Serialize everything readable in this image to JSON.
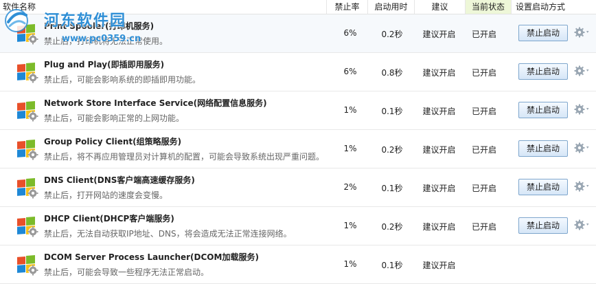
{
  "header": {
    "name": "软件名称",
    "rate": "禁止率",
    "time": "启动用时",
    "suggest": "建议",
    "state": "当前状态",
    "mode": "设置启动方式"
  },
  "watermark": {
    "title": "河东软件园",
    "url": "www.pc0359.cn"
  },
  "colors": {
    "state_header_bg": "#eef7d8",
    "button_border": "#7ea6cc",
    "watermark": "#2f8fd6"
  },
  "rows": [
    {
      "name": "Print Spooler(打印机服务)",
      "desc": "禁止后，打印机将无法正常使用。",
      "rate": "6%",
      "time": "0.2秒",
      "suggest": "建议开启",
      "state": "已开启",
      "button": "禁止启动",
      "has_button": true
    },
    {
      "name": "Plug and Play(即插即用服务)",
      "desc": "禁止后，可能会影响系统的即插即用功能。",
      "rate": "6%",
      "time": "0.8秒",
      "suggest": "建议开启",
      "state": "已开启",
      "button": "禁止启动",
      "has_button": true
    },
    {
      "name": "Network Store Interface Service(网络配置信息服务)",
      "desc": "禁止后，可能会影响正常的上网功能。",
      "rate": "1%",
      "time": "0.1秒",
      "suggest": "建议开启",
      "state": "已开启",
      "button": "禁止启动",
      "has_button": true
    },
    {
      "name": "Group Policy Client(组策略服务)",
      "desc": "禁止后，将不再应用管理员对计算机的配置，可能会导致系统出现严重问题。",
      "rate": "1%",
      "time": "0.2秒",
      "suggest": "建议开启",
      "state": "已开启",
      "button": "禁止启动",
      "has_button": true
    },
    {
      "name": "DNS Client(DNS客户端高速缓存服务)",
      "desc": "禁止后，打开网站的速度会变慢。",
      "rate": "2%",
      "time": "0.1秒",
      "suggest": "建议开启",
      "state": "已开启",
      "button": "禁止启动",
      "has_button": true
    },
    {
      "name": "DHCP Client(DHCP客户端服务)",
      "desc": "禁止后，无法自动获取IP地址、DNS，将会造成无法正常连接网络。",
      "rate": "1%",
      "time": "0.2秒",
      "suggest": "建议开启",
      "state": "已开启",
      "button": "禁止启动",
      "has_button": true
    },
    {
      "name": "DCOM Server Process Launcher(DCOM加载服务)",
      "desc": "禁止后，可能会导致一些程序无法正常启动。",
      "rate": "1%",
      "time": "0.1秒",
      "suggest": "建议开启",
      "state": "",
      "button": "",
      "has_button": false
    }
  ]
}
